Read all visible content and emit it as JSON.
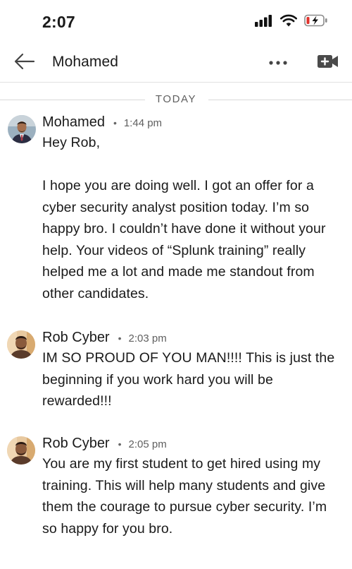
{
  "status_bar": {
    "time": "2:07",
    "icons": [
      "signal-icon",
      "wifi-icon",
      "battery-charging-icon"
    ],
    "battery_color": "#e0312b"
  },
  "header": {
    "title": "Mohamed",
    "back_icon": "arrow-left-icon",
    "more_icon": "more-horizontal-icon",
    "video_icon": "video-plus-icon"
  },
  "divider": {
    "label": "TODAY"
  },
  "messages": [
    {
      "sender": "Mohamed",
      "time": "1:44 pm",
      "paragraphs": [
        "Hey Rob,",
        "I hope you are doing well. I got an offer for a cyber security analyst position today. I’m so happy bro. I couldn’t have done it without your help. Your videos of “Splunk training” really helped me a lot and made me standout from other candidates."
      ]
    },
    {
      "sender": "Rob Cyber",
      "time": "2:03 pm",
      "paragraphs": [
        "IM SO PROUD OF YOU MAN!!!! This is just the beginning if you work hard you will be rewarded!!!"
      ]
    },
    {
      "sender": "Rob Cyber",
      "time": "2:05 pm",
      "paragraphs": [
        "You are my first student to get hired using my training. This will help many students and give them the courage to pursue cyber security. I’m so happy for you bro."
      ]
    }
  ]
}
